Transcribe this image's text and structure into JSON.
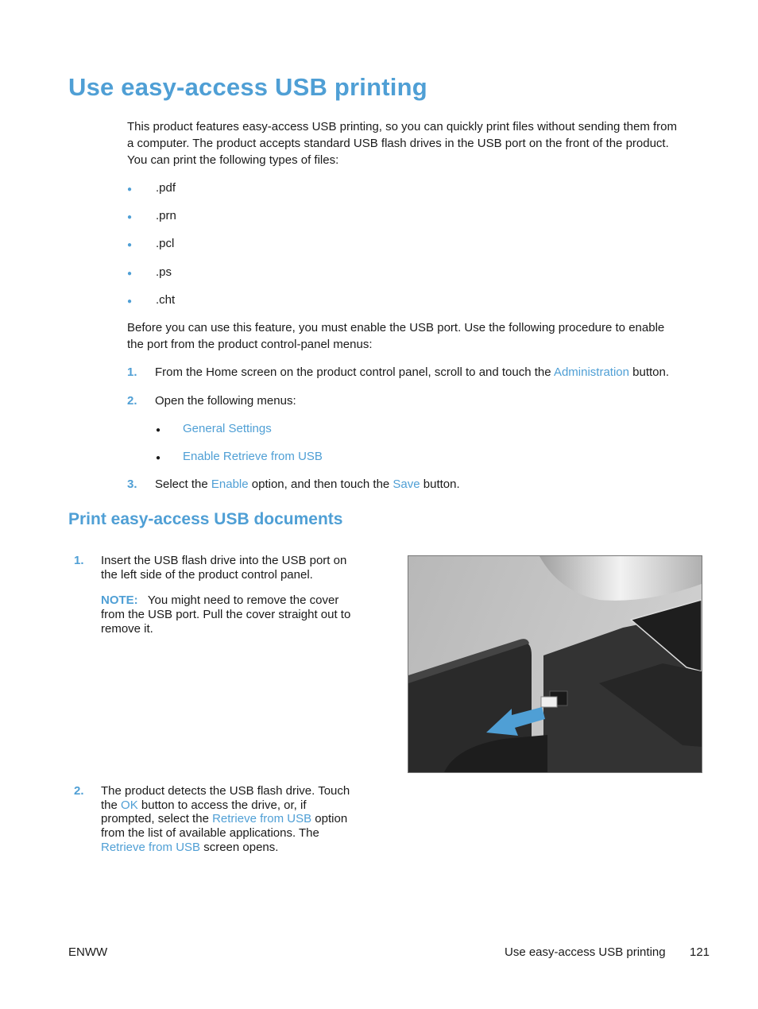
{
  "title": "Use easy-access USB printing",
  "intro": {
    "line1": "This product features easy-access USB printing, so you can quickly print files without sending them from",
    "line2": "a computer. The product accepts standard USB flash drives in the USB port on the front of the product.",
    "line3": "You can print the following types of files:"
  },
  "file_types": [
    ".pdf",
    ".prn",
    ".pcl",
    ".ps",
    ".cht"
  ],
  "enable_para": {
    "line1": "Before you can use this feature, you must enable the USB port. Use the following procedure to enable",
    "line2": "the port from the product control-panel menus:"
  },
  "steps": [
    {
      "num": "1.",
      "pre": "From the Home screen on the product control panel, scroll to and touch the ",
      "link": "Administration",
      "post": " button."
    },
    {
      "num": "2.",
      "text": "Open the following menus:",
      "menus": [
        "General Settings",
        "Enable Retrieve from USB"
      ]
    },
    {
      "num": "3.",
      "pre": "Select the ",
      "link1": "Enable",
      "mid": " option, and then touch the ",
      "link2": "Save",
      "post": " button."
    }
  ],
  "section2": {
    "title": "Print easy-access USB documents",
    "step1": {
      "num": "1.",
      "line1": "Insert the USB flash drive into the USB port on",
      "line2": "the left side of the product control panel.",
      "note_label": "NOTE:",
      "note_line1": "You might need to remove the cover",
      "note_line2": "from the USB port. Pull the cover straight out to",
      "note_line3": "remove it."
    },
    "step2": {
      "num": "2.",
      "l1": "The product detects the USB flash drive. Touch",
      "l2_pre": "the ",
      "l2_link": "OK",
      "l2_post": " button to access the drive, or, if",
      "l3_pre": "prompted, select the ",
      "l3_link": "Retrieve from USB",
      "l3_post": " option",
      "l4": "from the list of available applications. The",
      "l5_link": "Retrieve from USB",
      "l5_post": " screen opens."
    },
    "illustration_alt": "USB port on control panel with cover being removed"
  },
  "footer": {
    "left": "ENWW",
    "section": "Use easy-access USB printing",
    "page": "121"
  },
  "colors": {
    "accent": "#4f9fd5",
    "text": "#1a1a1a"
  }
}
